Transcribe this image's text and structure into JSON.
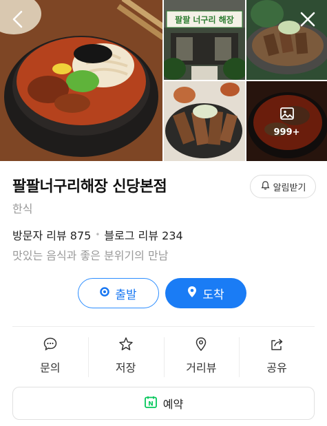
{
  "gallery": {
    "photo_count": "999+",
    "sign_text": "팔팔 너구리 해장"
  },
  "place": {
    "name": "팔팔너구리해장 신당본점",
    "category": "한식",
    "visitor_reviews": "방문자 리뷰 875",
    "blog_reviews": "블로그 리뷰 234",
    "tagline": "맛있는 음식과 좋은 분위기의 만남"
  },
  "alarm": {
    "label": "알림받기"
  },
  "route": {
    "depart_label": "출발",
    "arrive_label": "도착"
  },
  "actions": [
    {
      "label": "문의",
      "icon": "chat-bubble-icon"
    },
    {
      "label": "저장",
      "icon": "star-icon"
    },
    {
      "label": "거리뷰",
      "icon": "map-pin-icon"
    },
    {
      "label": "공유",
      "icon": "share-icon"
    }
  ],
  "reserve": {
    "label": "예약",
    "icon_letter": "N"
  },
  "colors": {
    "accent": "#1a7cf5",
    "naver_green": "#03c75a"
  }
}
